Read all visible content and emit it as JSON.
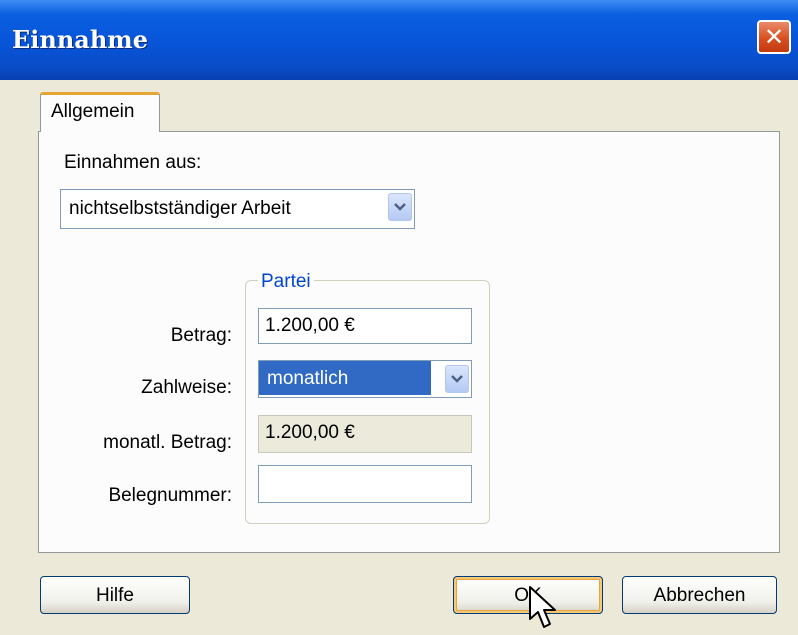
{
  "window": {
    "title": "Einnahme",
    "close_icon": "close-icon"
  },
  "tabs": [
    {
      "label": "Allgemein",
      "active": true
    }
  ],
  "form": {
    "source_label": "Einnahmen aus:",
    "source_value": "nichtselbstständiger Arbeit",
    "group_title": "Partei",
    "amount_label": "Betrag:",
    "amount_value": "1.200,00 €",
    "payment_label": "Zahlweise:",
    "payment_value": "monatlich",
    "monthly_label": "monatl. Betrag:",
    "monthly_value": "1.200,00 €",
    "receipt_label": "Belegnummer:",
    "receipt_value": ""
  },
  "buttons": {
    "help": "Hilfe",
    "ok": "OK",
    "cancel": "Abbrechen"
  },
  "colors": {
    "titlebar": "#0754d8",
    "accent": "#316ac5",
    "group_title": "#0046d5",
    "tab_highlight": "#e6a732"
  }
}
